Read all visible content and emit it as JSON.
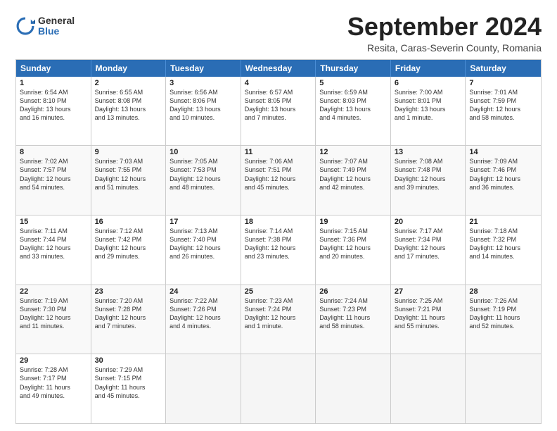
{
  "logo": {
    "general": "General",
    "blue": "Blue"
  },
  "title": "September 2024",
  "subtitle": "Resita, Caras-Severin County, Romania",
  "header_days": [
    "Sunday",
    "Monday",
    "Tuesday",
    "Wednesday",
    "Thursday",
    "Friday",
    "Saturday"
  ],
  "weeks": [
    [
      {
        "day": "1",
        "lines": [
          "Sunrise: 6:54 AM",
          "Sunset: 8:10 PM",
          "Daylight: 13 hours",
          "and 16 minutes."
        ]
      },
      {
        "day": "2",
        "lines": [
          "Sunrise: 6:55 AM",
          "Sunset: 8:08 PM",
          "Daylight: 13 hours",
          "and 13 minutes."
        ]
      },
      {
        "day": "3",
        "lines": [
          "Sunrise: 6:56 AM",
          "Sunset: 8:06 PM",
          "Daylight: 13 hours",
          "and 10 minutes."
        ]
      },
      {
        "day": "4",
        "lines": [
          "Sunrise: 6:57 AM",
          "Sunset: 8:05 PM",
          "Daylight: 13 hours",
          "and 7 minutes."
        ]
      },
      {
        "day": "5",
        "lines": [
          "Sunrise: 6:59 AM",
          "Sunset: 8:03 PM",
          "Daylight: 13 hours",
          "and 4 minutes."
        ]
      },
      {
        "day": "6",
        "lines": [
          "Sunrise: 7:00 AM",
          "Sunset: 8:01 PM",
          "Daylight: 13 hours",
          "and 1 minute."
        ]
      },
      {
        "day": "7",
        "lines": [
          "Sunrise: 7:01 AM",
          "Sunset: 7:59 PM",
          "Daylight: 12 hours",
          "and 58 minutes."
        ]
      }
    ],
    [
      {
        "day": "8",
        "lines": [
          "Sunrise: 7:02 AM",
          "Sunset: 7:57 PM",
          "Daylight: 12 hours",
          "and 54 minutes."
        ]
      },
      {
        "day": "9",
        "lines": [
          "Sunrise: 7:03 AM",
          "Sunset: 7:55 PM",
          "Daylight: 12 hours",
          "and 51 minutes."
        ]
      },
      {
        "day": "10",
        "lines": [
          "Sunrise: 7:05 AM",
          "Sunset: 7:53 PM",
          "Daylight: 12 hours",
          "and 48 minutes."
        ]
      },
      {
        "day": "11",
        "lines": [
          "Sunrise: 7:06 AM",
          "Sunset: 7:51 PM",
          "Daylight: 12 hours",
          "and 45 minutes."
        ]
      },
      {
        "day": "12",
        "lines": [
          "Sunrise: 7:07 AM",
          "Sunset: 7:49 PM",
          "Daylight: 12 hours",
          "and 42 minutes."
        ]
      },
      {
        "day": "13",
        "lines": [
          "Sunrise: 7:08 AM",
          "Sunset: 7:48 PM",
          "Daylight: 12 hours",
          "and 39 minutes."
        ]
      },
      {
        "day": "14",
        "lines": [
          "Sunrise: 7:09 AM",
          "Sunset: 7:46 PM",
          "Daylight: 12 hours",
          "and 36 minutes."
        ]
      }
    ],
    [
      {
        "day": "15",
        "lines": [
          "Sunrise: 7:11 AM",
          "Sunset: 7:44 PM",
          "Daylight: 12 hours",
          "and 33 minutes."
        ]
      },
      {
        "day": "16",
        "lines": [
          "Sunrise: 7:12 AM",
          "Sunset: 7:42 PM",
          "Daylight: 12 hours",
          "and 29 minutes."
        ]
      },
      {
        "day": "17",
        "lines": [
          "Sunrise: 7:13 AM",
          "Sunset: 7:40 PM",
          "Daylight: 12 hours",
          "and 26 minutes."
        ]
      },
      {
        "day": "18",
        "lines": [
          "Sunrise: 7:14 AM",
          "Sunset: 7:38 PM",
          "Daylight: 12 hours",
          "and 23 minutes."
        ]
      },
      {
        "day": "19",
        "lines": [
          "Sunrise: 7:15 AM",
          "Sunset: 7:36 PM",
          "Daylight: 12 hours",
          "and 20 minutes."
        ]
      },
      {
        "day": "20",
        "lines": [
          "Sunrise: 7:17 AM",
          "Sunset: 7:34 PM",
          "Daylight: 12 hours",
          "and 17 minutes."
        ]
      },
      {
        "day": "21",
        "lines": [
          "Sunrise: 7:18 AM",
          "Sunset: 7:32 PM",
          "Daylight: 12 hours",
          "and 14 minutes."
        ]
      }
    ],
    [
      {
        "day": "22",
        "lines": [
          "Sunrise: 7:19 AM",
          "Sunset: 7:30 PM",
          "Daylight: 12 hours",
          "and 11 minutes."
        ]
      },
      {
        "day": "23",
        "lines": [
          "Sunrise: 7:20 AM",
          "Sunset: 7:28 PM",
          "Daylight: 12 hours",
          "and 7 minutes."
        ]
      },
      {
        "day": "24",
        "lines": [
          "Sunrise: 7:22 AM",
          "Sunset: 7:26 PM",
          "Daylight: 12 hours",
          "and 4 minutes."
        ]
      },
      {
        "day": "25",
        "lines": [
          "Sunrise: 7:23 AM",
          "Sunset: 7:24 PM",
          "Daylight: 12 hours",
          "and 1 minute."
        ]
      },
      {
        "day": "26",
        "lines": [
          "Sunrise: 7:24 AM",
          "Sunset: 7:23 PM",
          "Daylight: 11 hours",
          "and 58 minutes."
        ]
      },
      {
        "day": "27",
        "lines": [
          "Sunrise: 7:25 AM",
          "Sunset: 7:21 PM",
          "Daylight: 11 hours",
          "and 55 minutes."
        ]
      },
      {
        "day": "28",
        "lines": [
          "Sunrise: 7:26 AM",
          "Sunset: 7:19 PM",
          "Daylight: 11 hours",
          "and 52 minutes."
        ]
      }
    ],
    [
      {
        "day": "29",
        "lines": [
          "Sunrise: 7:28 AM",
          "Sunset: 7:17 PM",
          "Daylight: 11 hours",
          "and 49 minutes."
        ]
      },
      {
        "day": "30",
        "lines": [
          "Sunrise: 7:29 AM",
          "Sunset: 7:15 PM",
          "Daylight: 11 hours",
          "and 45 minutes."
        ]
      },
      {
        "day": "",
        "lines": []
      },
      {
        "day": "",
        "lines": []
      },
      {
        "day": "",
        "lines": []
      },
      {
        "day": "",
        "lines": []
      },
      {
        "day": "",
        "lines": []
      }
    ]
  ]
}
